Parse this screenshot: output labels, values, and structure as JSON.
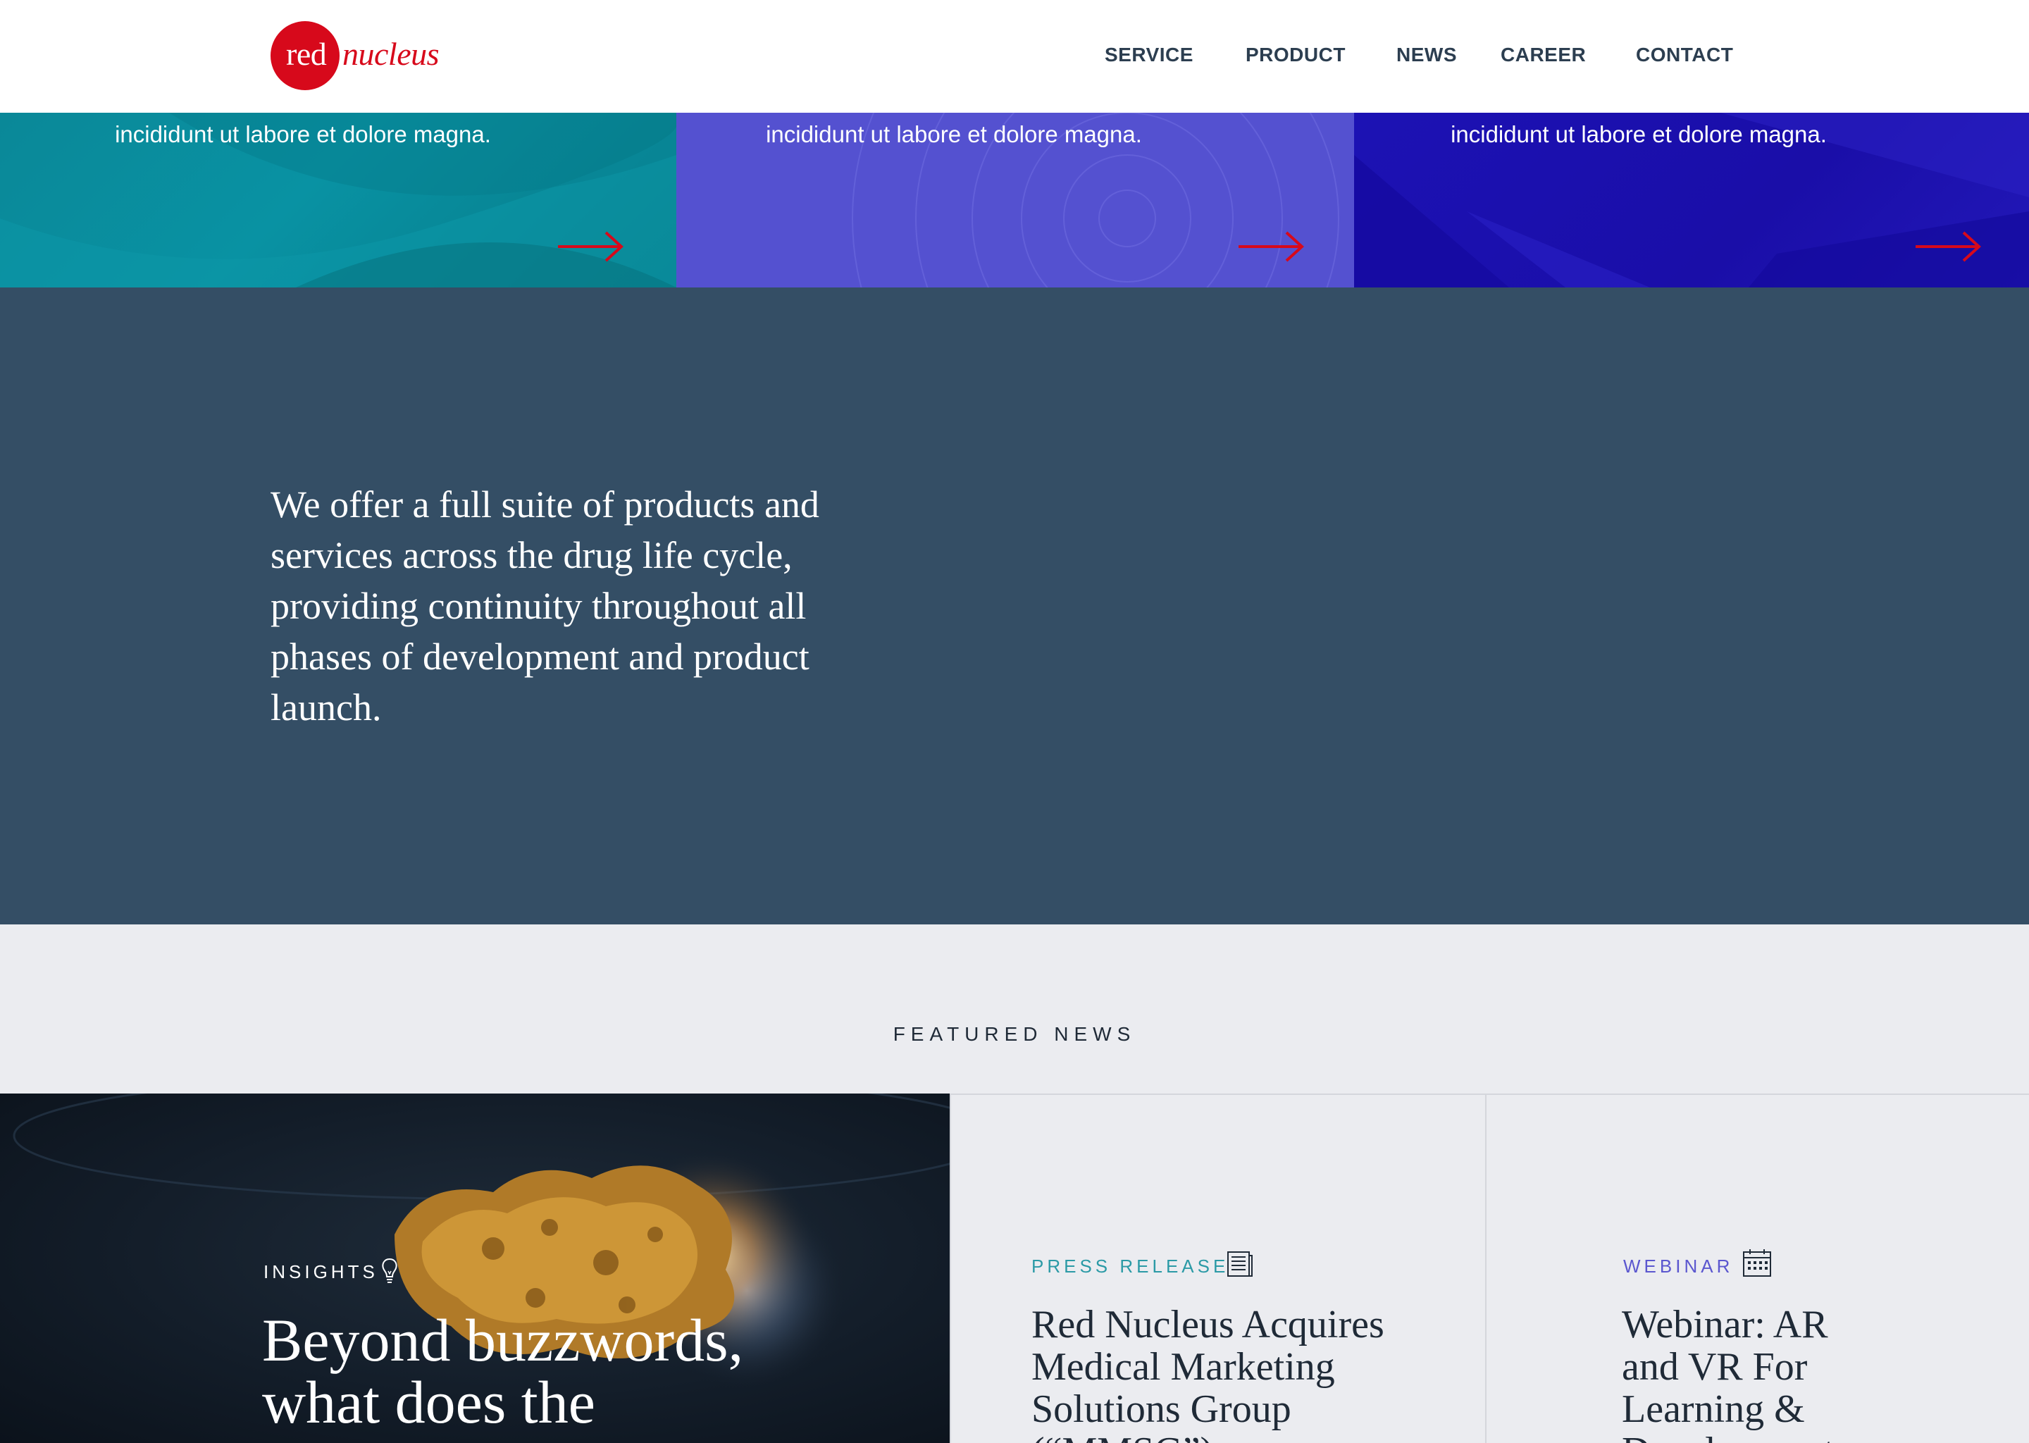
{
  "brand": {
    "logo_red": "red",
    "logo_nucleus": "nucleus",
    "brand_red": "#d7091b"
  },
  "nav": {
    "items": [
      {
        "label": "SERVICE"
      },
      {
        "label": "PRODUCT"
      },
      {
        "label": "NEWS"
      },
      {
        "label": "CAREER"
      },
      {
        "label": "CONTACT"
      }
    ]
  },
  "hero_tiles": [
    {
      "text": "incididunt ut labore et dolore magna.",
      "color": "#0a8898",
      "arrow_icon": "arrow-right-icon"
    },
    {
      "text": "incididunt ut labore et dolore magna.",
      "color": "#5451d0",
      "arrow_icon": "arrow-right-icon"
    },
    {
      "text": "incididunt ut labore et dolore magna.",
      "color": "#1c12b4",
      "arrow_icon": "arrow-right-icon"
    }
  ],
  "intro": {
    "text_lines": [
      "We offer a full suite of products and",
      "services across the drug life cycle,",
      "providing continuity throughout all",
      "phases of development and product",
      "launch."
    ],
    "background": "#344e65"
  },
  "featured_news": {
    "heading": "FEATURED NEWS",
    "cards": [
      {
        "tag": "INSIGHTS",
        "icon": "lightbulb-icon",
        "title_lines": [
          "Beyond buzzwords,",
          "what does the"
        ]
      },
      {
        "tag": "PRESS RELEASE",
        "icon": "newspaper-icon",
        "tag_color": "#2b9aa6",
        "title_lines": [
          "Red Nucleus Acquires",
          "Medical Marketing",
          "Solutions Group",
          "(“MMSG”)"
        ]
      },
      {
        "tag": "WEBINAR",
        "icon": "calendar-icon",
        "tag_color": "#5b57cf",
        "title_lines": [
          "Webinar: AR",
          "and VR For",
          "Learning &",
          "Development"
        ]
      }
    ]
  }
}
